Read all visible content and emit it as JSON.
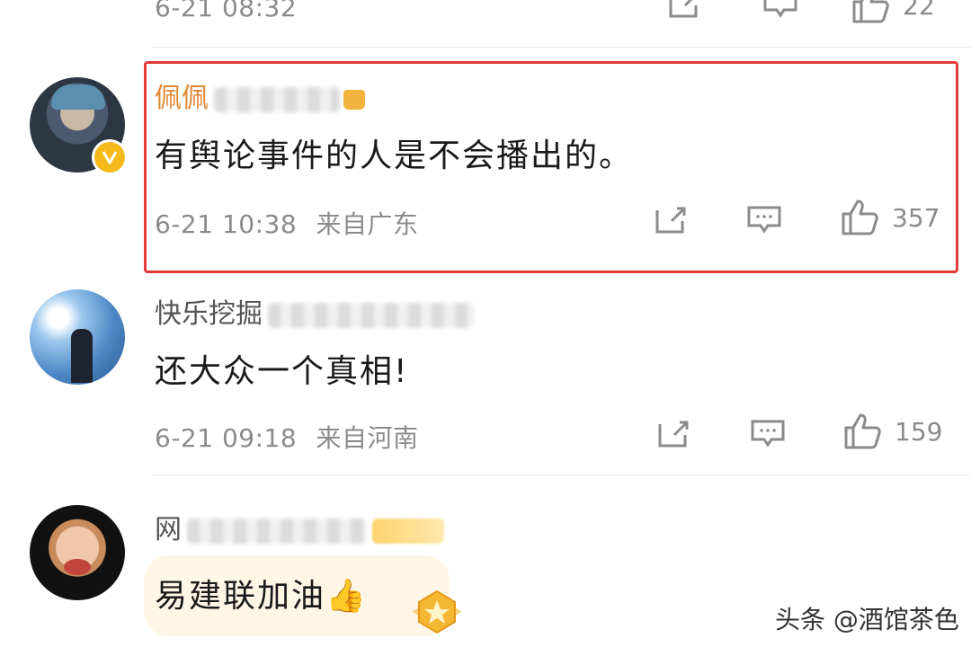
{
  "colors": {
    "highlight": "#e23a3a",
    "meta_text": "#8b8b8b",
    "vip_name": "#e0862f",
    "verified": "#f6b91c"
  },
  "top_comment": {
    "time": "6-21 08:32",
    "likes": "22"
  },
  "comments": [
    {
      "name": "佩佩",
      "content": "有舆论事件的人是不会播出的。",
      "time": "6-21 10:38",
      "location": "来自广东",
      "likes": "357",
      "highlighted": true,
      "verified_icon": "verified-badge-icon"
    },
    {
      "name": "快乐挖掘",
      "content": "还大众一个真相!",
      "time": "6-21 09:18",
      "location": "来自河南",
      "likes": "159"
    },
    {
      "name": "网",
      "content": "易建联加油👍"
    }
  ],
  "icons": {
    "share": "share-icon",
    "comment": "comment-icon",
    "like": "like-icon"
  },
  "watermark": "头条 @酒馆茶色"
}
